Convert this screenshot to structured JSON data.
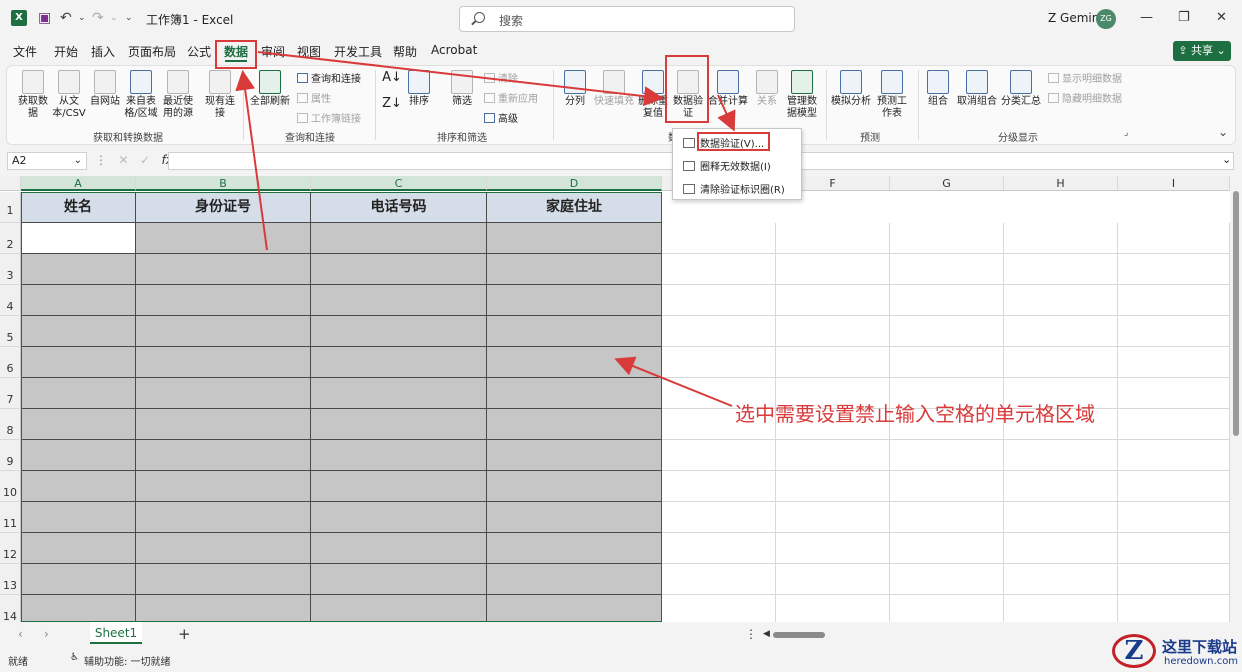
{
  "titlebar": {
    "app_icon": "X",
    "save_icon": "save-icon",
    "doc_title": "工作簿1 - Excel",
    "search_placeholder": "搜索",
    "user_name": "Z Gemini",
    "avatar_initials": "ZG"
  },
  "menu": {
    "items": [
      "文件",
      "开始",
      "插入",
      "页面布局",
      "公式",
      "数据",
      "审阅",
      "视图",
      "开发工具",
      "帮助",
      "Acrobat"
    ],
    "active": "数据",
    "share_label": "共享"
  },
  "ribbon": {
    "get_data": "获取数据",
    "from_csv": "从文本/CSV",
    "from_web": "自网站",
    "from_table": "来自表格/区域",
    "recent_sources": "最近使用的源",
    "existing_conn": "现有连接",
    "refresh_all": "全部刷新",
    "queries_conn": "查询和连接",
    "properties": "属性",
    "edit_links": "工作簿链接",
    "sort": "排序",
    "filter": "筛选",
    "clear": "清除",
    "reapply": "重新应用",
    "advanced": "高级",
    "text_to_cols": "分列",
    "flash_fill": "快速填充",
    "remove_dup": "删除重复值",
    "data_validation": "数据验证",
    "consolidate": "合并计算",
    "relations": "关系",
    "data_model": "管理数据模型",
    "what_if": "模拟分析",
    "forecast_sheet": "预测工作表",
    "group": "组合",
    "ungroup": "取消组合",
    "subtotal": "分类汇总",
    "show_detail": "显示明细数据",
    "hide_detail": "隐藏明细数据",
    "groups": {
      "get_transform": "获取和转换数据",
      "queries": "查询和连接",
      "sort_filter": "排序和筛选",
      "data_tools": "数",
      "forecast": "预测",
      "outline": "分级显示"
    }
  },
  "dropdown": {
    "items": [
      "数据验证(V)...",
      "圈释无效数据(I)",
      "清除验证标识圈(R)"
    ]
  },
  "formula_bar": {
    "name_box": "A2",
    "fx": "fx"
  },
  "grid": {
    "columns": [
      "A",
      "B",
      "C",
      "D",
      "E",
      "F",
      "G",
      "H",
      "I"
    ],
    "rows": [
      "1",
      "2",
      "3",
      "4",
      "5",
      "6",
      "7",
      "8",
      "9",
      "10",
      "11",
      "12",
      "13",
      "14"
    ],
    "headers": [
      "姓名",
      "身份证号",
      "电话号码",
      "家庭住址"
    ]
  },
  "annotation": {
    "text": "选中需要设置禁止输入空格的单元格区域"
  },
  "sheets": {
    "tabs": [
      "Sheet1"
    ],
    "add": "+"
  },
  "status": {
    "ready": "就绪",
    "accessibility": "辅助功能: 一切就绪"
  },
  "watermark": {
    "logo_letter": "Z",
    "site_name": "这里下载站",
    "url": "heredown.com"
  },
  "colors": {
    "accent": "#1d6f42",
    "annotation_red": "#d93a3a",
    "header_fill": "#d5dde8",
    "selection_fill": "#c6c6c6"
  }
}
